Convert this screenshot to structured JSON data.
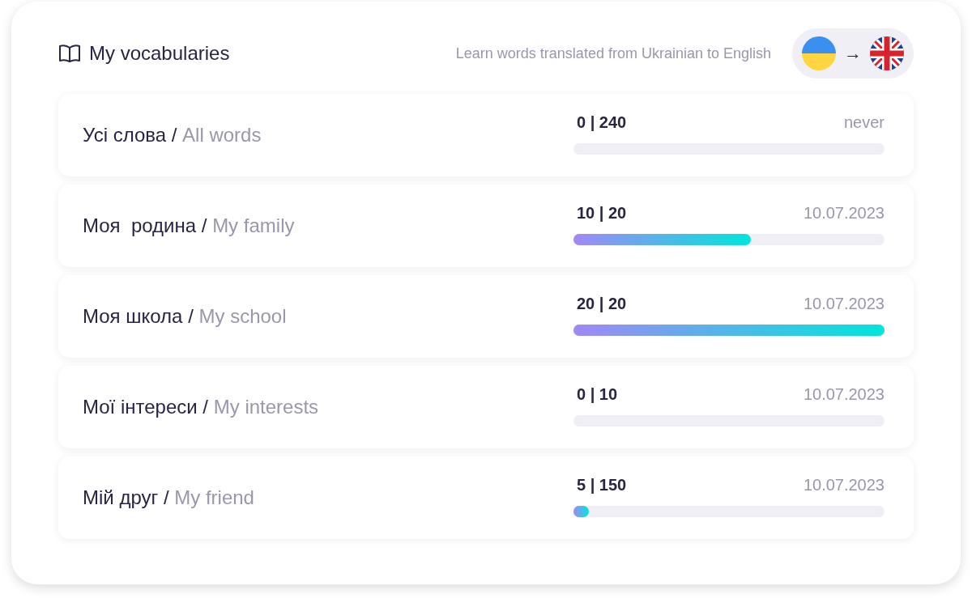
{
  "header": {
    "title": "My vocabularies",
    "subtitle": "Learn words translated from Ukrainian to English",
    "arrow": "→"
  },
  "vocabularies": [
    {
      "name": "Усі слова",
      "separator": "/",
      "translation": "All words",
      "count": "0 | 240",
      "last_date": "never"
    },
    {
      "name": "Моя  родина",
      "separator": "/",
      "translation": "My family",
      "count": "10 | 20",
      "level": 0.57,
      "last_date": "10.07.2023"
    },
    {
      "name": "Моя школа",
      "separator": "/",
      "translation": "My school",
      "count": "20 | 20",
      "level": 1,
      "last_date": "10.07.2023"
    },
    {
      "name": "Мої інтереси",
      "separator": "/",
      "translation": "My interests",
      "count": "0 | 10",
      "last_date": "10.07.2023"
    },
    {
      "name": "Мій друг",
      "separator": "/",
      "translation": "My friend",
      "count": "5 | 150",
      "level": 0.05,
      "last_date": "10.07.2023"
    }
  ]
}
